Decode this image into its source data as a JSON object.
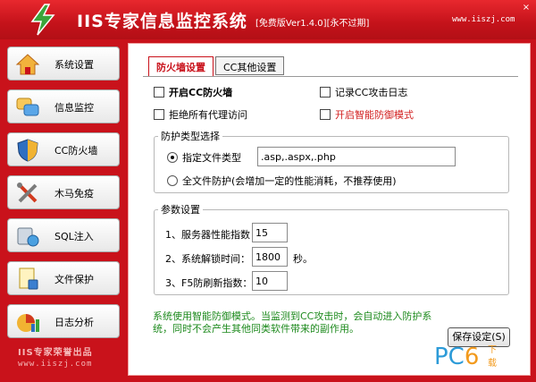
{
  "window": {
    "title": "IIS专家信息监控系统",
    "version": "[免费版Ver1.4.0][永不过期]",
    "site": "www.iiszj.com",
    "controls": [
      "×"
    ],
    "colors": {
      "titlebar": "#c9121b",
      "accent_red": "#d21f1f",
      "note_green": "#1d8a1d"
    }
  },
  "sidebar": {
    "items": [
      {
        "label": "系统设置",
        "icon": "home-icon"
      },
      {
        "label": "信息监控",
        "icon": "chat-icon"
      },
      {
        "label": "CC防火墙",
        "icon": "shield-icon"
      },
      {
        "label": "木马免疫",
        "icon": "tools-icon"
      },
      {
        "label": "SQL注入",
        "icon": "database-icon"
      },
      {
        "label": "文件保护",
        "icon": "document-lock-icon"
      },
      {
        "label": "日志分析",
        "icon": "chart-icon"
      }
    ],
    "footer_title": "IIS专家荣誉出品",
    "footer_url": "www.iiszj.com"
  },
  "tabs": [
    {
      "label": "防火墙设置",
      "active": true
    },
    {
      "label": "CC其他设置",
      "active": false
    }
  ],
  "options": {
    "enable_cc": "开启CC防火墙",
    "log_cc": "记录CC攻击日志",
    "reject_proxy": "拒绝所有代理访问",
    "smart_defense": "开启智能防御模式"
  },
  "protection_type": {
    "legend": "防护类型选择",
    "specified": "指定文件类型",
    "file_types_value": ".asp,.aspx,.php",
    "full": "全文件防护(会增加一定的性能消耗，不推荐使用)"
  },
  "params": {
    "legend": "参数设置",
    "perf_label": "1、服务器性能指数",
    "perf_value": "15",
    "unlock_label": "2、系统解锁时间：",
    "unlock_value": "1800",
    "unlock_unit": "秒。",
    "f5_label": "3、F5防刷新指数：",
    "f5_value": "10"
  },
  "note": "系统使用智能防御模式。当监测到CC攻击时，会自动进入防护系统，同时不会产生其他同类软件带来的副作用。",
  "save_button": "保存设定(S)",
  "watermark": {
    "pc": "PC",
    "six": "6",
    "dl": "下载"
  }
}
